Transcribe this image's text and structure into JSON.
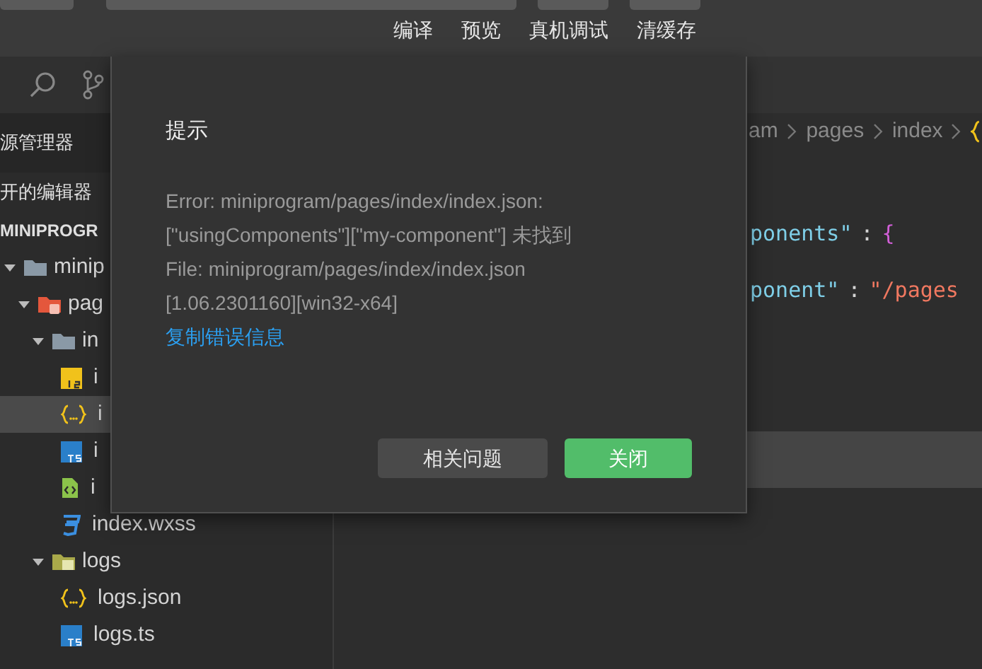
{
  "toolbar": {
    "actions": [
      "编译",
      "预览",
      "真机调试",
      "清缓存"
    ]
  },
  "sidebar": {
    "header": "源管理器",
    "open_editors": "开的编辑器",
    "project": "MINIPROGR",
    "tree": [
      {
        "kind": "folder",
        "name": "minip",
        "expanded": true,
        "selected": false,
        "children": [
          {
            "kind": "pages",
            "name": "pag",
            "expanded": true,
            "selected": false,
            "children": [
              {
                "kind": "folder",
                "name": "in",
                "expanded": true,
                "selected": false,
                "children": [
                  {
                    "kind": "js",
                    "name": "i",
                    "selected": false
                  },
                  {
                    "kind": "json",
                    "name": "i",
                    "selected": true
                  },
                  {
                    "kind": "ts",
                    "name": "i",
                    "selected": false
                  },
                  {
                    "kind": "wxml",
                    "name": "i",
                    "selected": false
                  },
                  {
                    "kind": "wxss",
                    "name": "index.wxss",
                    "selected": false
                  }
                ]
              },
              {
                "kind": "logs",
                "name": "logs",
                "expanded": true,
                "selected": false,
                "children": [
                  {
                    "kind": "json",
                    "name": "logs.json",
                    "selected": false
                  },
                  {
                    "kind": "ts",
                    "name": "logs.ts",
                    "selected": false
                  }
                ]
              }
            ]
          }
        ]
      }
    ]
  },
  "editor": {
    "breadcrumb": [
      "am",
      "pages",
      "index"
    ],
    "lines": [
      [
        {
          "kind": "key",
          "text": "ponents\""
        },
        {
          "kind": "punct",
          "text": ":"
        },
        {
          "kind": "brace",
          "text": "{"
        }
      ],
      [
        {
          "kind": "key",
          "text": "ponent\""
        },
        {
          "kind": "punct",
          "text": ":"
        },
        {
          "kind": "string",
          "text": "\"/pages"
        }
      ]
    ]
  },
  "dialog": {
    "title": "提示",
    "lines": [
      "Error: miniprogram/pages/index/index.json:",
      "[\"usingComponents\"][\"my-component\"] 未找到",
      "File: miniprogram/pages/index/index.json",
      "[1.06.2301160][win32-x64]"
    ],
    "link": "复制错误信息",
    "buttons": [
      {
        "kind": "secondary",
        "label": "相关问题"
      },
      {
        "kind": "primary",
        "label": "关闭"
      }
    ]
  }
}
